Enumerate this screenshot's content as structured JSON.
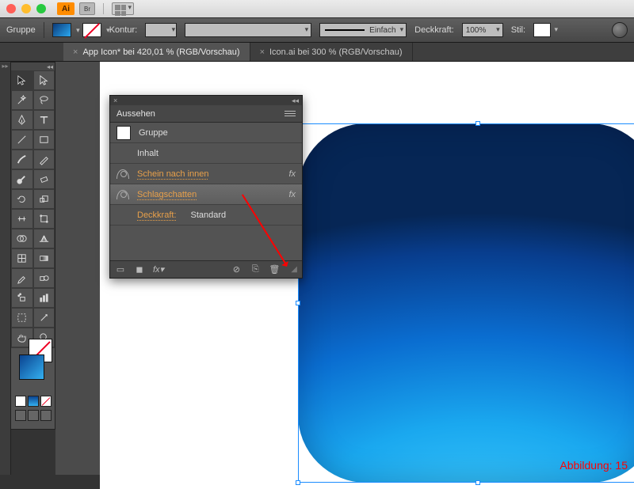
{
  "app": {
    "badge": "Ai",
    "br_label": "Br"
  },
  "controlbar": {
    "selection_label": "Gruppe",
    "stroke_label": "Kontur:",
    "stroke_weight": "",
    "brush_label": "Einfach",
    "opacity_label": "Deckkraft:",
    "opacity_value": "100%",
    "style_label": "Stil:"
  },
  "tabs": [
    {
      "label": "App Icon* bei 420,01 % (RGB/Vorschau)",
      "active": true
    },
    {
      "label": "Icon.ai bei 300 % (RGB/Vorschau)",
      "active": false
    }
  ],
  "appearance_panel": {
    "title": "Aussehen",
    "group_label": "Gruppe",
    "content_label": "Inhalt",
    "effects": [
      {
        "name": "Schein nach innen",
        "selected": false
      },
      {
        "name": "Schlagschatten",
        "selected": true
      }
    ],
    "opacity_label": "Deckkraft:",
    "opacity_value": "Standard",
    "fx_label": "fx"
  },
  "figure_caption": "Abbildung: 15",
  "icons": {
    "close": "×",
    "collapse": "◂◂",
    "expand": "▸▸",
    "dropdown": "▾",
    "forbidden": "⊘",
    "duplicate": "⎘",
    "trash": "🗑",
    "new": "▫"
  }
}
